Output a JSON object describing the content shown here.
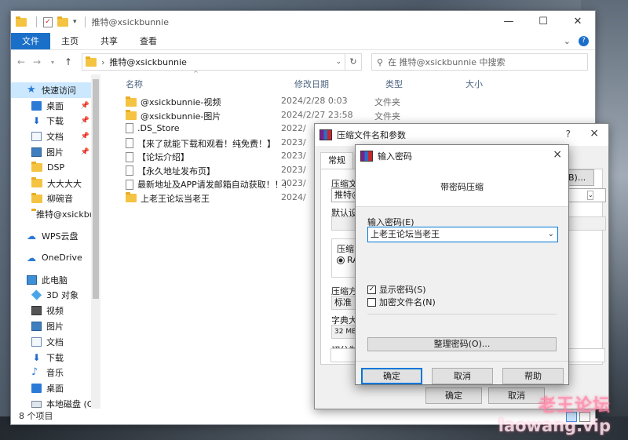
{
  "explorer": {
    "title": "推特@xsickbunnie",
    "ribbon_tabs": [
      "文件",
      "主页",
      "共享",
      "查看"
    ],
    "address_path": "推特@xsickbunnie",
    "search_placeholder": "在 推特@xsickbunnie 中搜索",
    "columns": {
      "name": "名称",
      "date": "修改日期",
      "type": "类型",
      "size": "大小"
    },
    "nav": {
      "quick_access": "快速访问",
      "items": [
        "桌面",
        "下载",
        "文档",
        "图片",
        "DSP",
        "大大大大",
        "柳碗音",
        "推特@xsickbunnie"
      ],
      "wps": "WPS云盘",
      "onedrive": "OneDrive",
      "this_pc": "此电脑",
      "pc_items": [
        "3D 对象",
        "视频",
        "图片",
        "文档",
        "下载",
        "音乐",
        "桌面",
        "本地磁盘 (C:)"
      ]
    },
    "files": [
      {
        "name": "@xsickbunnie-视频",
        "date": "2024/2/28 0:03",
        "type": "文件夹",
        "kind": "folder"
      },
      {
        "name": "@xsickbunnie-图片",
        "date": "2024/2/27 23:58",
        "type": "文件夹",
        "kind": "folder"
      },
      {
        "name": ".DS_Store",
        "date": "2022/",
        "type": "",
        "kind": "file"
      },
      {
        "name": "【来了就能下载和观看！纯免费！】",
        "date": "2023/",
        "type": "",
        "kind": "file"
      },
      {
        "name": "【论坛介绍】",
        "date": "2023/",
        "type": "",
        "kind": "file"
      },
      {
        "name": "【永久地址发布页】",
        "date": "2023/",
        "type": "",
        "kind": "file"
      },
      {
        "name": "最新地址及APP请发邮箱自动获取！！！",
        "date": "2023/",
        "type": "",
        "kind": "file"
      },
      {
        "name": "上老王论坛当老王",
        "date": "2024/",
        "type": "",
        "kind": "folder"
      }
    ],
    "status": "8 个项目"
  },
  "archive_dialog": {
    "title": "压缩文件名和参数",
    "help": "?",
    "close": "×",
    "tab_normal": "常规",
    "label_name": "压缩文",
    "name_value": "推特@",
    "browse_button": "(B)...",
    "label_profile": "默认设",
    "label_format": "压缩",
    "format_radio": "RA",
    "label_method": "压缩方",
    "method_value": "标准",
    "label_dict": "字典大",
    "dict_value": "32 MB",
    "label_split": "切分为",
    "ok": "确定",
    "cancel": "取消"
  },
  "password_dialog": {
    "title": "输入密码",
    "close": "×",
    "header": "带密码压缩",
    "label_enter": "输入密码(E)",
    "password_value": "上老王论坛当老王",
    "show_password": "显示密码(S)",
    "encrypt_names": "加密文件名(N)",
    "show_checked": true,
    "encrypt_checked": false,
    "organize_button": "整理密码(O)...",
    "ok": "确定",
    "cancel": "取消",
    "help": "帮助"
  },
  "watermark": {
    "line1": "老王论坛",
    "line2": "laowang.vip"
  },
  "colors": {
    "accent": "#1a6fc9",
    "selection": "#cce8ff",
    "folder": "#f5c342"
  }
}
